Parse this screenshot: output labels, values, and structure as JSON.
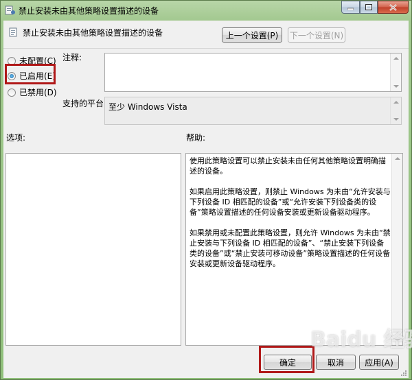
{
  "window": {
    "title": "禁止安装未由其他策略设置描述的设备"
  },
  "header": {
    "policy_title": "禁止安装未由其他策略设置描述的设备",
    "prev_button": "上一个设置(P)",
    "next_button": "下一个设置(N)"
  },
  "options": {
    "not_configured": "未配置(C)",
    "enabled": "已启用(E)",
    "disabled": "已禁用(D)",
    "selected": "enabled"
  },
  "labels": {
    "comment": "注释:",
    "supported_on": "支持的平台:",
    "options": "选项:",
    "help": "帮助:"
  },
  "supported_value": "至少 Windows Vista",
  "comment_value": "",
  "help_text": {
    "p1": "使用此策略设置可以禁止安装未由任何其他策略设置明确描述的设备。",
    "p2": "如果启用此策略设置，则禁止 Windows 为未由“允许安装与下列设备 ID 相匹配的设备”或“允许安装下列设备类的设备”策略设置描述的任何设备安装或更新设备驱动程序。",
    "p3": "如果禁用或未配置此策略设置，则允许 Windows 为未由“禁止安装与下列设备 ID 相匹配的设备”、“禁止安装下列设备类的设备”或“禁止安装可移动设备”策略设置描述的任何设备安装或更新设备驱动程序。"
  },
  "buttons": {
    "ok": "确定",
    "cancel": "取消",
    "apply": "应用(A)"
  },
  "watermark": "Baidu 经验",
  "colors": {
    "highlight": "#b01818",
    "titlebar": "#a2c88f"
  }
}
